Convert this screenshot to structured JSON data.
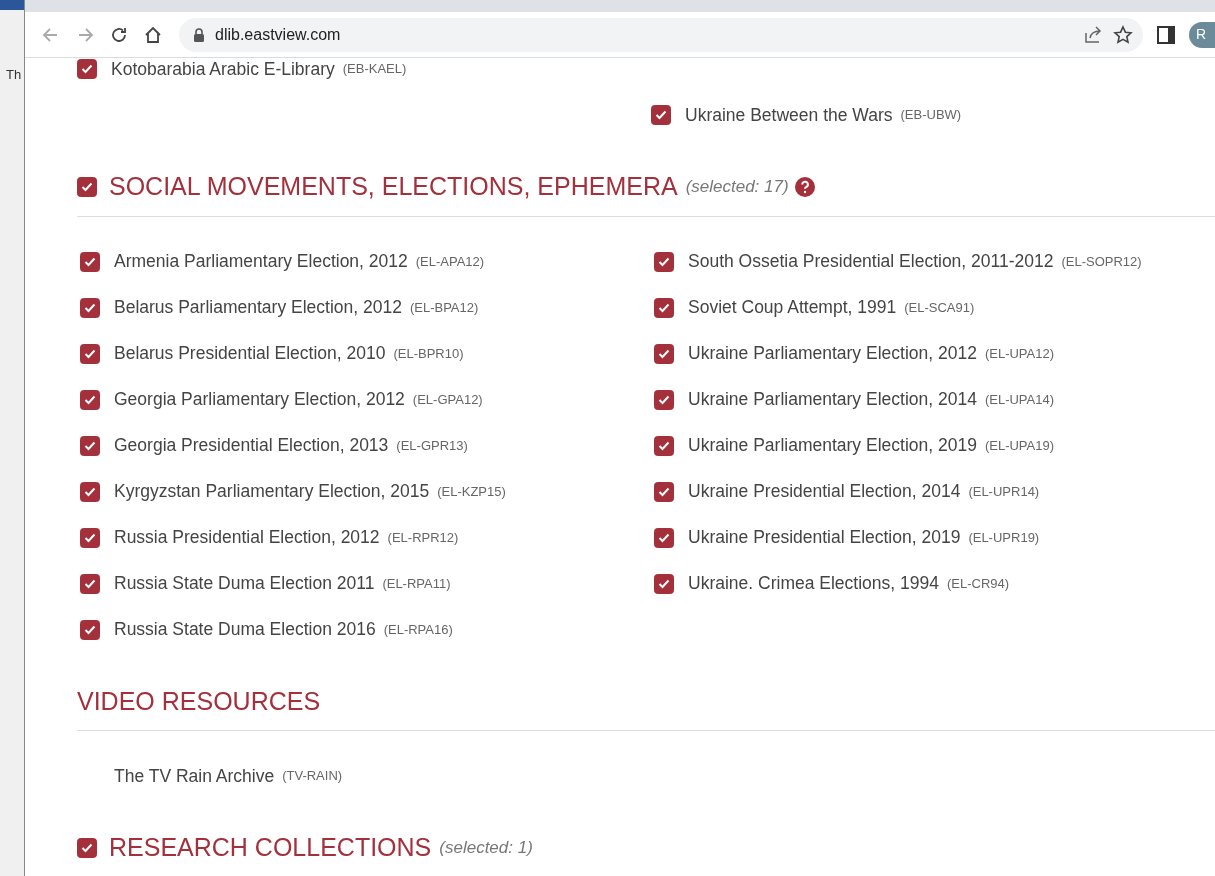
{
  "background_window": {
    "text": "Th"
  },
  "browser": {
    "url": "dlib.eastview.com",
    "profile_initial": "R"
  },
  "clipped_section": {
    "columns": [
      [
        {
          "title": "Kotobarabia Arabic E-Library",
          "code": "(EB-KAEL)",
          "checked": true
        }
      ],
      [
        {
          "title": "Ukraine Between the Wars",
          "code": "(EB-UBW)",
          "checked": true
        }
      ]
    ]
  },
  "sections": [
    {
      "title": "SOCIAL MOVEMENTS, ELECTIONS, EPHEMERA",
      "selected_text": "(selected: 17)",
      "checked": true,
      "help": true,
      "columns": [
        [
          {
            "title": "Armenia Parliamentary Election, 2012",
            "code": "(EL-APA12)",
            "checked": true
          },
          {
            "title": "Belarus Parliamentary Election, 2012",
            "code": "(EL-BPA12)",
            "checked": true
          },
          {
            "title": "Belarus Presidential Election, 2010",
            "code": "(EL-BPR10)",
            "checked": true
          },
          {
            "title": "Georgia Parliamentary Election, 2012",
            "code": "(EL-GPA12)",
            "checked": true
          },
          {
            "title": "Georgia Presidential Election, 2013",
            "code": "(EL-GPR13)",
            "checked": true
          },
          {
            "title": "Kyrgyzstan Parliamentary Election, 2015",
            "code": "(EL-KZP15)",
            "checked": true
          },
          {
            "title": "Russia Presidential Election, 2012",
            "code": "(EL-RPR12)",
            "checked": true
          },
          {
            "title": "Russia State Duma Election 2011",
            "code": "(EL-RPA11)",
            "checked": true
          },
          {
            "title": "Russia State Duma Election 2016",
            "code": "(EL-RPA16)",
            "checked": true
          }
        ],
        [
          {
            "title": "South Ossetia Presidential Election, 2011-2012",
            "code": "(EL-SOPR12)",
            "checked": true
          },
          {
            "title": "Soviet Coup Attempt, 1991",
            "code": "(EL-SCA91)",
            "checked": true
          },
          {
            "title": "Ukraine Parliamentary Election, 2012",
            "code": "(EL-UPA12)",
            "checked": true
          },
          {
            "title": "Ukraine Parliamentary Election, 2014",
            "code": "(EL-UPA14)",
            "checked": true
          },
          {
            "title": "Ukraine Parliamentary Election, 2019",
            "code": "(EL-UPA19)",
            "checked": true
          },
          {
            "title": "Ukraine Presidential Election, 2014",
            "code": "(EL-UPR14)",
            "checked": true
          },
          {
            "title": "Ukraine Presidential Election, 2019",
            "code": "(EL-UPR19)",
            "checked": true
          },
          {
            "title": "Ukraine. Crimea Elections, 1994",
            "code": "(EL-CR94)",
            "checked": true
          }
        ]
      ]
    },
    {
      "title": "VIDEO RESOURCES",
      "columns": [
        [
          {
            "title": "The TV Rain Archive",
            "code": "(TV-RAIN)",
            "kind": "plain"
          }
        ]
      ]
    },
    {
      "title": "RESEARCH COLLECTIONS",
      "selected_text": "(selected: 1)",
      "checked": true
    }
  ]
}
